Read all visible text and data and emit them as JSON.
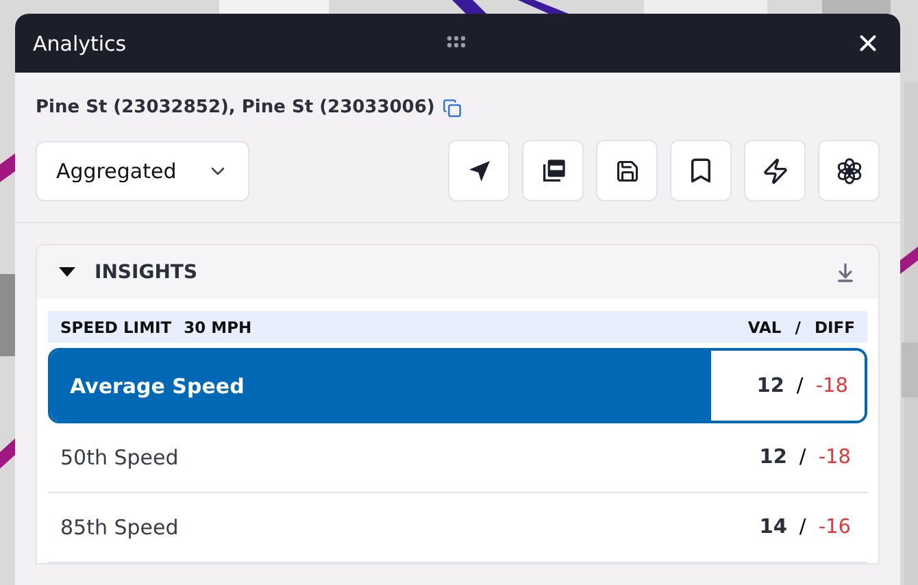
{
  "window": {
    "title": "Analytics"
  },
  "location": {
    "label": "Pine St (23032852), Pine St (23033006)"
  },
  "view_select": {
    "value": "Aggregated"
  },
  "insights": {
    "title": "INSIGHTS",
    "expanded": true,
    "header": {
      "label": "SPEED LIMIT",
      "limit": "30 MPH",
      "val": "VAL",
      "separator": "/",
      "diff": "DIFF"
    },
    "rows": [
      {
        "name": "Average Speed",
        "val": "12",
        "separator": "/",
        "diff": "-18",
        "selected": true
      },
      {
        "name": "50th Speed",
        "val": "12",
        "separator": "/",
        "diff": "-18",
        "selected": false
      },
      {
        "name": "85th Speed",
        "val": "14",
        "separator": "/",
        "diff": "-16",
        "selected": false
      }
    ]
  }
}
